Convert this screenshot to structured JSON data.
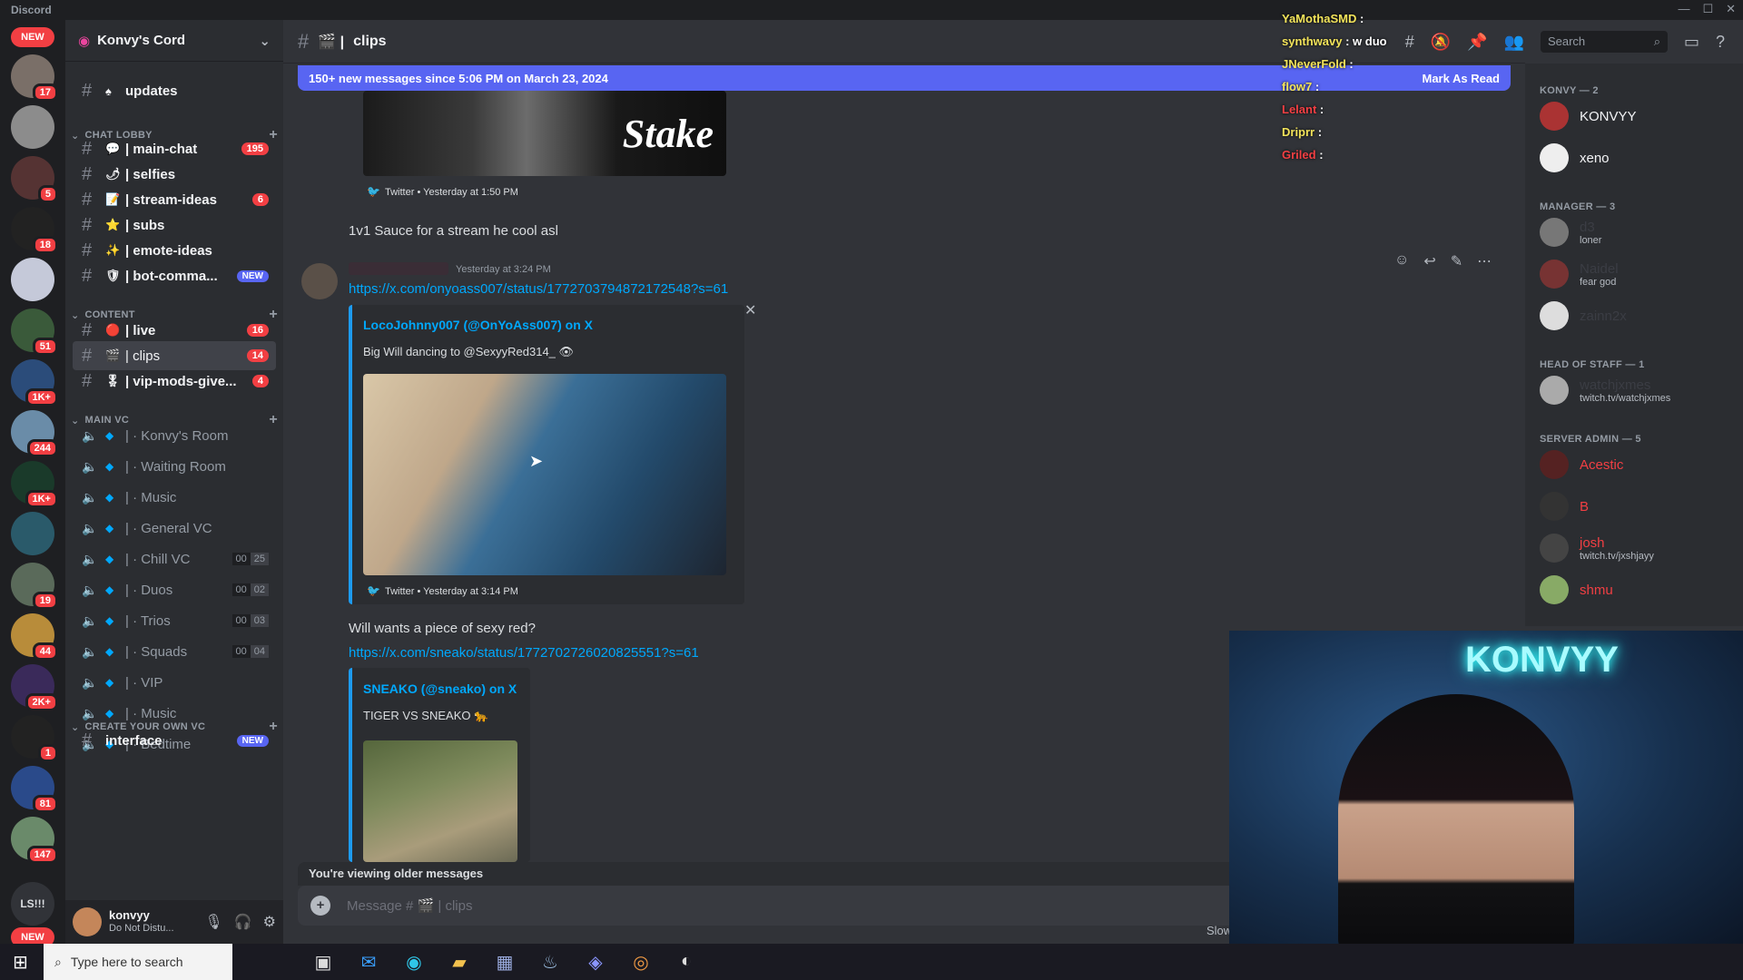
{
  "window": {
    "title": "Discord"
  },
  "servers": {
    "top_badge": "NEW",
    "bottom_badge": "NEW",
    "text_icon": "LS!!!",
    "items": [
      {
        "badge": "17"
      },
      {
        "badge": ""
      },
      {
        "badge": "5"
      },
      {
        "badge": "18"
      },
      {
        "badge": ""
      },
      {
        "badge": "51"
      },
      {
        "badge": "1K+"
      },
      {
        "badge": "244"
      },
      {
        "badge": "1K+"
      },
      {
        "badge": ""
      },
      {
        "badge": "19"
      },
      {
        "badge": "44"
      },
      {
        "badge": "2K+"
      },
      {
        "badge": "1"
      },
      {
        "badge": "81"
      },
      {
        "badge": "147"
      }
    ]
  },
  "guild": {
    "name": "Konvy's Cord"
  },
  "sidebar": {
    "top_channel": "updates",
    "categories": {
      "chat": "CHAT LOBBY",
      "content": "CONTENT",
      "mainvc": "MAIN VC",
      "create": "CREATE YOUR OWN VC"
    },
    "text_channels": [
      {
        "name": "main-chat",
        "badge": "195"
      },
      {
        "name": "selfies",
        "badge": ""
      },
      {
        "name": "stream-ideas",
        "badge": "6"
      },
      {
        "name": "subs",
        "badge": ""
      },
      {
        "name": "emote-ideas",
        "badge": ""
      },
      {
        "name": "bot-comma...",
        "badge": "NEW"
      },
      {
        "name": "live",
        "badge": "16"
      },
      {
        "name": "clips",
        "badge": "14"
      },
      {
        "name": "vip-mods-give...",
        "badge": "4"
      }
    ],
    "voice_channels": [
      {
        "name": "Konvy's Room",
        "a": "",
        "b": ""
      },
      {
        "name": "Waiting Room",
        "a": "",
        "b": ""
      },
      {
        "name": "Music",
        "a": "",
        "b": ""
      },
      {
        "name": "General VC",
        "a": "",
        "b": ""
      },
      {
        "name": "Chill VC",
        "a": "00",
        "b": "25"
      },
      {
        "name": "Duos",
        "a": "00",
        "b": "02"
      },
      {
        "name": "Trios",
        "a": "00",
        "b": "03"
      },
      {
        "name": "Squads",
        "a": "00",
        "b": "04"
      },
      {
        "name": "VIP",
        "a": "",
        "b": ""
      },
      {
        "name": "Music",
        "a": "",
        "b": ""
      },
      {
        "name": "Bedtime",
        "a": "",
        "b": ""
      }
    ],
    "interface": {
      "name": "interface",
      "badge": "NEW"
    }
  },
  "user": {
    "name": "konvyy",
    "status": "Do Not Distu..."
  },
  "header": {
    "channel": "clips"
  },
  "search": {
    "placeholder": "Search"
  },
  "banner": {
    "text": "150+ new messages since 5:06 PM on March 23, 2024",
    "action": "Mark As Read"
  },
  "messages": {
    "m1_footer": "Twitter • Yesterday at 1:50 PM",
    "m1_text": "1v1 Sauce for a stream he cool asl",
    "m1_image_text": "Stake",
    "m2_time": "Yesterday at 3:24 PM",
    "m2_link": "https://x.com/onyoass007/status/1772703794872172548?s=61",
    "m2_embed_title": "LocoJohnny007 (@OnYoAss007) on X",
    "m2_embed_desc": "Big Will dancing to @SexyyRed314_ 👁",
    "m2_footer": "Twitter • Yesterday at 3:14 PM",
    "m3_text": "Will wants a piece of sexy red?",
    "m3_link": "https://x.com/sneako/status/1772702726020825551?s=61",
    "m3_embed_title": "SNEAKO (@sneako) on X",
    "m3_embed_desc": "TIGER VS SNEAKO 🐆"
  },
  "older": {
    "text": "You're viewing older messages"
  },
  "composer": {
    "placeholder": "Message # 🎬 | clips"
  },
  "slowmode": {
    "text": "Slow"
  },
  "members": {
    "groups": [
      {
        "title": "KONVY — 2",
        "items": [
          {
            "name": "KONVYY",
            "sub": "",
            "color": "#f2f3f5"
          },
          {
            "name": "xeno",
            "sub": "",
            "color": "#f2f3f5"
          }
        ]
      },
      {
        "title": "MANAGER — 3",
        "items": [
          {
            "name": "d3",
            "sub": "loner",
            "color": "#3b3d44"
          },
          {
            "name": "Naidel",
            "sub": "fear god",
            "color": "#3b3d44"
          },
          {
            "name": "zainn2x",
            "sub": "",
            "color": "#3b3d44"
          }
        ]
      },
      {
        "title": "HEAD OF STAFF — 1",
        "items": [
          {
            "name": "watchjxmes",
            "sub": "twitch.tv/watchjxmes",
            "color": "#3b3d44"
          }
        ]
      },
      {
        "title": "SERVER ADMIN — 5",
        "items": [
          {
            "name": "Acestic",
            "sub": "",
            "color": "#f23f43"
          },
          {
            "name": "B",
            "sub": "",
            "color": "#f23f43"
          },
          {
            "name": "josh",
            "sub": "twitch.tv/jxshjayy",
            "color": "#f23f43"
          },
          {
            "name": "shmu",
            "sub": "",
            "color": "#f23f43"
          }
        ]
      }
    ]
  },
  "overlay": {
    "lines": [
      {
        "name": "YaMothaSMD",
        "msg": ":",
        "color": "#f2e35a"
      },
      {
        "name": "synthwavy",
        "msg": ": w duo",
        "color": "#f2e35a"
      },
      {
        "name": "JNeverFold",
        "msg": ":",
        "color": "#f2e35a"
      },
      {
        "name": "flow7",
        "msg": ":",
        "color": "#f2e35a"
      },
      {
        "name": "Lelant",
        "msg": ":",
        "color": "#f23f43"
      },
      {
        "name": "Driprr",
        "msg": ":",
        "color": "#f2e35a"
      },
      {
        "name": "Griled",
        "msg": ":",
        "color": "#f23f43"
      }
    ]
  },
  "webcam": {
    "sign": "KONVYY"
  },
  "taskbar": {
    "search_placeholder": "Type here to search"
  }
}
